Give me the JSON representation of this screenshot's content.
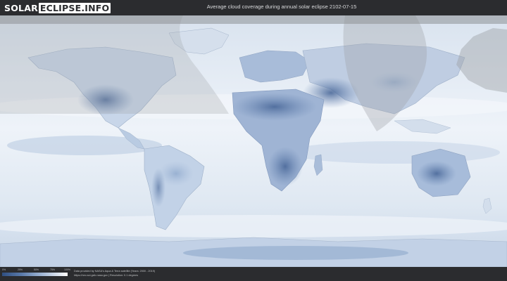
{
  "header": {
    "logo_part1": "SOLAR",
    "logo_part2": "ECLIPSE.INFO",
    "title": "Average cloud coverage during annual solar eclipse 2102-07-15"
  },
  "legend": {
    "ticks": [
      "0%",
      "25%",
      "50%",
      "75%",
      "100%"
    ],
    "colors": [
      "#2f4f82",
      "#5b7bab",
      "#9fb5d4",
      "#d7e1ee",
      "#ffffff"
    ]
  },
  "credits": {
    "line1": "Data provided by NASA's Aqua & Terra satellite (Years: 2000 - 2019)",
    "line2": "https://neo.sci.gsfc.nasa.gov | Resolution: 0.1 degrees"
  },
  "colors": {
    "background": "#2a2b2e",
    "ocean_cloud": "#e8eef6",
    "clear_sky": "#4d6b9e",
    "eclipse_path_shade": "#b9bcc0"
  }
}
